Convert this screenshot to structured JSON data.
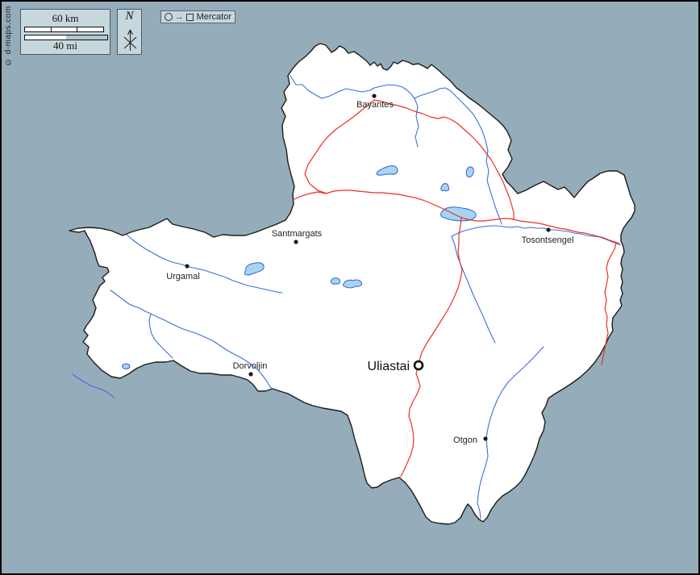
{
  "map": {
    "towns": [
      {
        "name": "Bayantes"
      },
      {
        "name": "Santmargats"
      },
      {
        "name": "Tosontsengel"
      },
      {
        "name": "Urgamal"
      },
      {
        "name": "Dorvoljin"
      },
      {
        "name": "Uliastai"
      },
      {
        "name": "Otgon"
      }
    ],
    "capital": "Uliastai"
  },
  "scale": {
    "km_label": "60 km",
    "mi_label": "40 mi"
  },
  "compass": {
    "north_label": "N"
  },
  "projection": {
    "label": "Mercator",
    "arrow_glyph": "→"
  },
  "copyright": "© d-maps.com",
  "colors": {
    "background": "#95acba",
    "panel": "#c6d7dd",
    "map_fill": "#ffffff",
    "boundary": "#1c1c1c",
    "river": "#3a6fd8",
    "lake_fill": "#a8d4f4",
    "lake_stroke": "#2d62cc",
    "road": "#ee2e24",
    "town": "#1a1a1a",
    "text": "#222222"
  }
}
